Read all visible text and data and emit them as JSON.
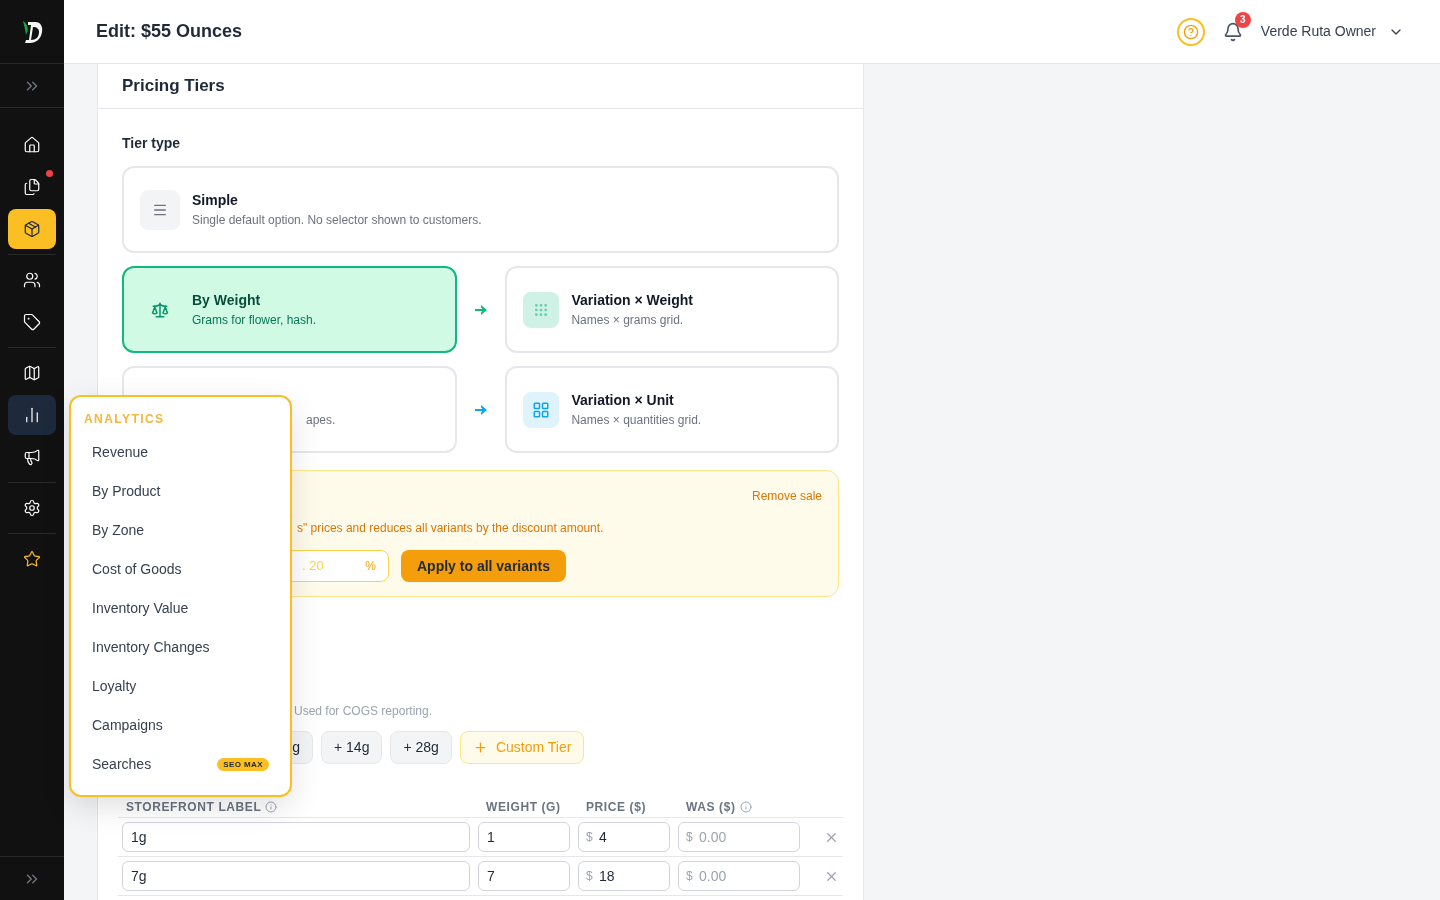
{
  "header": {
    "title": "Edit: $55 Ounces",
    "notification_count": "3",
    "user_name": "Verde Ruta Owner"
  },
  "sidebar": {
    "groups": [
      {
        "items": [
          {
            "selected": false,
            "highlighted": false,
            "dot": false
          },
          {
            "selected": false,
            "highlighted": false,
            "dot": true
          },
          {
            "selected": true,
            "highlighted": false,
            "dot": false
          }
        ]
      },
      {
        "items": [
          {
            "selected": false,
            "highlighted": false,
            "dot": false
          },
          {
            "selected": false,
            "highlighted": false,
            "dot": false
          }
        ]
      },
      {
        "items": [
          {
            "selected": false,
            "highlighted": false,
            "dot": false
          },
          {
            "selected": false,
            "highlighted": true,
            "dot": false
          },
          {
            "selected": false,
            "highlighted": false,
            "dot": false
          }
        ]
      },
      {
        "items": [
          {
            "selected": false,
            "highlighted": false,
            "dot": false
          }
        ]
      },
      {
        "items": [
          {
            "selected": false,
            "highlighted": false,
            "dot": false
          }
        ]
      }
    ]
  },
  "section": {
    "title": "Pricing Tiers",
    "tier_type_label": "Tier type",
    "simple": {
      "title": "Simple",
      "description": "Single default option. No selector shown to customers.",
      "selected": false
    },
    "tier_rows": [
      {
        "base": {
          "title": "By Weight",
          "description": "Grams for flower, hash.",
          "selected": true
        },
        "variation": {
          "title": "Variation × Weight",
          "description": "Names × grams grid.",
          "color": "#10b981"
        }
      },
      {
        "base": {
          "description": "apes.",
          "selected": false
        },
        "variation": {
          "title": "Variation × Unit",
          "description": "Names × quantities grid.",
          "color": "#0ea5e9"
        }
      }
    ],
    "sale": {
      "remove_link": "Remove sale",
      "description": "s\" prices and reduces all variants by the discount amount.",
      "input_placeholder": ". 20",
      "input_suffix": "%",
      "apply_button": "Apply to all variants"
    },
    "cost_hint": "Used for COGS reporting.",
    "chips": [
      "g",
      "+ 14g",
      "+ 28g"
    ],
    "custom_tier_button": "Custom Tier",
    "table": {
      "columns": [
        {
          "label": "STOREFRONT LABEL",
          "info": true
        },
        {
          "label": "WEIGHT (G)",
          "info": false
        },
        {
          "label": "PRICE ($)",
          "info": false
        },
        {
          "label": "WAS ($)",
          "info": true
        }
      ],
      "rows": [
        {
          "label": "1g",
          "weight": "1",
          "price_prefix": "$",
          "price": "4",
          "was_prefix": "$",
          "was_placeholder": "0.00"
        },
        {
          "label": "7g",
          "weight": "7",
          "price_prefix": "$",
          "price": "18",
          "was_prefix": "$",
          "was_placeholder": "0.00"
        }
      ]
    }
  },
  "flyout": {
    "heading": "ANALYTICS",
    "items": [
      {
        "label": "Revenue"
      },
      {
        "label": "By Product"
      },
      {
        "label": "By Zone"
      },
      {
        "label": "Cost of Goods"
      },
      {
        "label": "Inventory Value"
      },
      {
        "label": "Inventory Changes"
      },
      {
        "label": "Loyalty"
      },
      {
        "label": "Campaigns"
      },
      {
        "label": "Searches",
        "badge": "SEO MAX"
      }
    ]
  }
}
